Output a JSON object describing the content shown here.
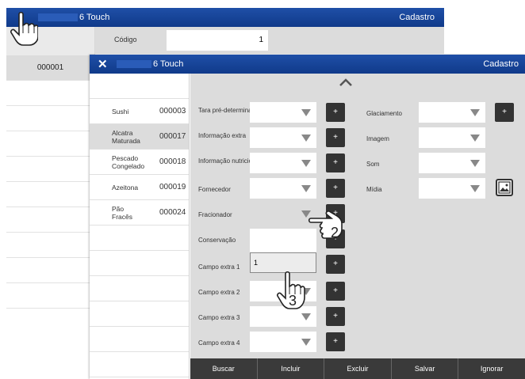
{
  "background_window": {
    "title_short": "6 Touch",
    "title_right": "Cadastro",
    "codigo_label": "Código",
    "codigo_value": "1",
    "list_items": [
      "",
      "000001",
      "",
      "",
      "",
      "",
      "",
      "",
      "",
      "",
      "",
      ""
    ]
  },
  "dialog": {
    "close": "✕",
    "title": "6 Touch",
    "title_right": "Cadastro",
    "items": [
      {
        "name": "Sushi",
        "code": "000003"
      },
      {
        "name": "Alcatra Maturada",
        "code": "000017"
      },
      {
        "name": "Pescado Congelado",
        "code": "000018"
      },
      {
        "name": "Azeitona",
        "code": "000019"
      },
      {
        "name": "Pão Fracês",
        "code": "000024"
      }
    ],
    "left_fields": [
      {
        "label": "Tara pré-determinada"
      },
      {
        "label": "Informação extra"
      },
      {
        "label": "Informação nutricional"
      },
      {
        "label": "Fornecedor"
      },
      {
        "label": "Fracionador"
      },
      {
        "label": "Conservação"
      },
      {
        "label": "Campo extra 1",
        "value": "1"
      },
      {
        "label": "Campo extra 2"
      },
      {
        "label": "Campo extra 3"
      },
      {
        "label": "Campo extra 4"
      }
    ],
    "right_fields": [
      {
        "label": "Glaciamento"
      },
      {
        "label": "Imagem"
      },
      {
        "label": "Som"
      },
      {
        "label": "Mídia"
      }
    ],
    "plus_label": "+",
    "footer": [
      "Buscar",
      "Incluir",
      "Excluir",
      "Salvar",
      "Ignorar"
    ]
  },
  "annotations": {
    "step2": "2",
    "step3": "3"
  },
  "icons": [
    "hand-pointer-icon",
    "close-icon",
    "chevron-up-icon",
    "dropdown-arrow-icon",
    "image-icon"
  ]
}
